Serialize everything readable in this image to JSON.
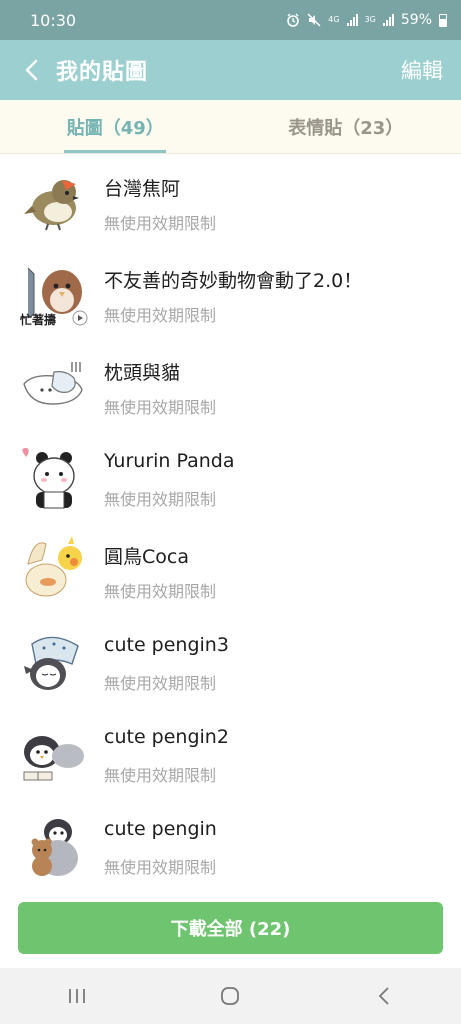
{
  "status_bar": {
    "time": "10:30",
    "battery": "59%",
    "net_a": "4G",
    "net_b": "3G"
  },
  "header": {
    "title": "我的貼圖",
    "edit_label": "編輯"
  },
  "tabs": [
    {
      "label": "貼圖（49）",
      "active": true
    },
    {
      "label": "表情貼（23）",
      "active": false
    }
  ],
  "stickers": [
    {
      "name": "台灣焦阿",
      "validity": "無使用效期限制",
      "icon": "sparrow-sticker-icon"
    },
    {
      "name": "不友善的奇妙動物會動了2.0！",
      "validity": "無使用效期限制",
      "icon": "bird-with-fish-sticker-icon",
      "thumb_text": "忙著擣"
    },
    {
      "name": "枕頭與貓",
      "validity": "無使用效期限制",
      "icon": "pillow-cat-sticker-icon"
    },
    {
      "name": "Yururin Panda",
      "validity": "無使用效期限制",
      "icon": "panda-sticker-icon"
    },
    {
      "name": "圓鳥Coca",
      "validity": "無使用效期限制",
      "icon": "cockatiel-sticker-icon"
    },
    {
      "name": "cute pengin3",
      "validity": "無使用效期限制",
      "icon": "penguin-sleeping-sticker-icon"
    },
    {
      "name": "cute pengin2",
      "validity": "無使用效期限制",
      "icon": "penguin-reading-sticker-icon"
    },
    {
      "name": "cute pengin",
      "validity": "無使用效期限制",
      "icon": "penguin-teddy-sticker-icon"
    }
  ],
  "download_all_label": "下載全部 (22)",
  "colors": {
    "header": "#9ccfcf",
    "status_bar": "#7aa3a3",
    "tab_active": "#76b3b3",
    "download": "#6fc46f"
  }
}
